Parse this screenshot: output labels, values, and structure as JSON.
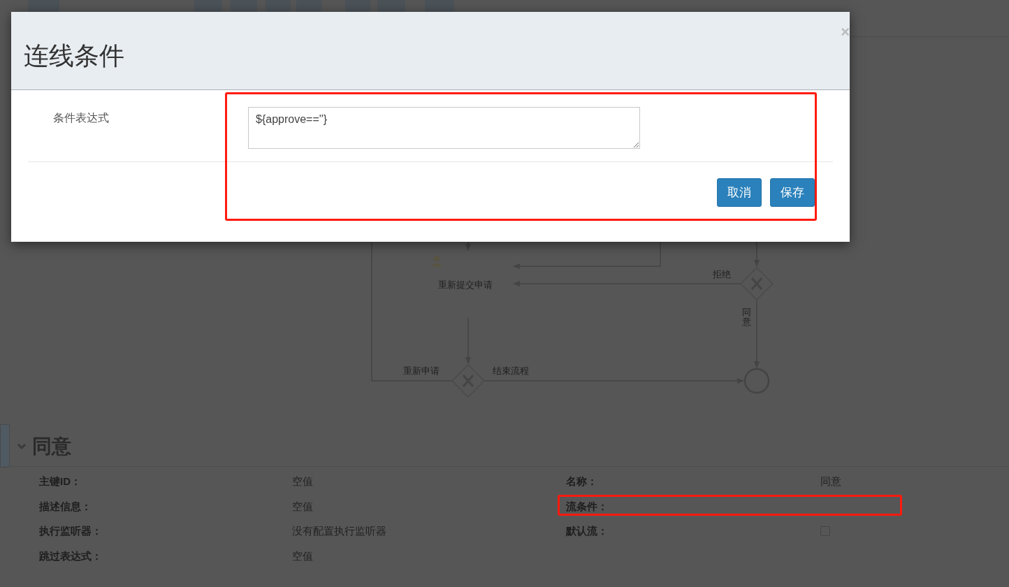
{
  "diagram": {
    "task": {
      "label": "重新提交申请"
    },
    "flow_labels": [
      {
        "label": "拒绝",
        "kind": "horizontal"
      },
      {
        "label": "同意",
        "kind": "vertical"
      },
      {
        "label": "重新申请",
        "kind": "horizontal"
      },
      {
        "label": "结束流程",
        "kind": "horizontal"
      }
    ]
  },
  "properties": {
    "title": "同意",
    "expanded": true,
    "left": [
      {
        "label": "主键ID：",
        "value": "空值",
        "kind": "text"
      },
      {
        "label": "描述信息：",
        "value": "空值",
        "kind": "text"
      },
      {
        "label": "执行监听器：",
        "value": "没有配置执行监听器",
        "kind": "text"
      },
      {
        "label": "跳过表达式：",
        "value": "空值",
        "kind": "text"
      }
    ],
    "right": [
      {
        "label": "名称：",
        "value": "同意",
        "kind": "text"
      },
      {
        "label": "流条件：",
        "kind": "text"
      },
      {
        "label": "默认流：",
        "kind": "checkbox",
        "checked": false
      }
    ]
  },
  "dialog": {
    "title": "连线条件",
    "close": "×",
    "field": {
      "label": "条件表达式",
      "value": "${approve==''}"
    },
    "buttons": [
      {
        "label": "取消"
      },
      {
        "label": "保存"
      }
    ]
  }
}
